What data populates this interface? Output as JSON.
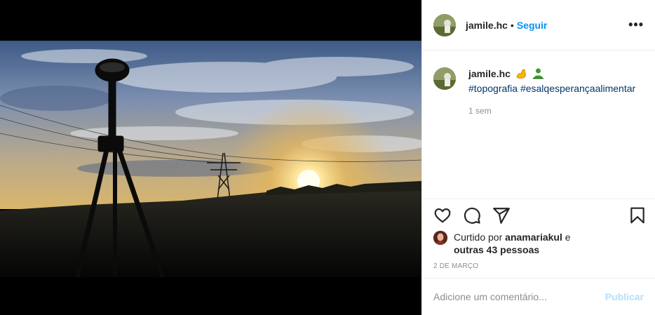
{
  "header": {
    "username": "jamile.hc",
    "separator": "•",
    "follow_label": "Seguir",
    "more_label": "•••"
  },
  "caption": {
    "username": "jamile.hc",
    "emojis": [
      "flexed-biceps-icon",
      "green-figure-icon"
    ],
    "hashtags": [
      "#topografia",
      "#esalqesperançaalimentar"
    ],
    "time": "1 sem"
  },
  "actions": {
    "like_icon": "heart-icon",
    "comment_icon": "comment-icon",
    "share_icon": "paper-plane-icon",
    "save_icon": "bookmark-icon"
  },
  "likes": {
    "prefix": "Curtido por",
    "liker": "anamariakul",
    "connector": "e",
    "others": "outras 43 pessoas"
  },
  "date": "2 DE MARÇO",
  "comment_box": {
    "placeholder": "Adicione um comentário...",
    "publish_label": "Publicar"
  },
  "colors": {
    "link_blue": "#0095f6",
    "hashtag_blue": "#00376b",
    "muted": "#8e8e8e",
    "publish_disabled": "#b2dffc",
    "border": "#efefef"
  }
}
